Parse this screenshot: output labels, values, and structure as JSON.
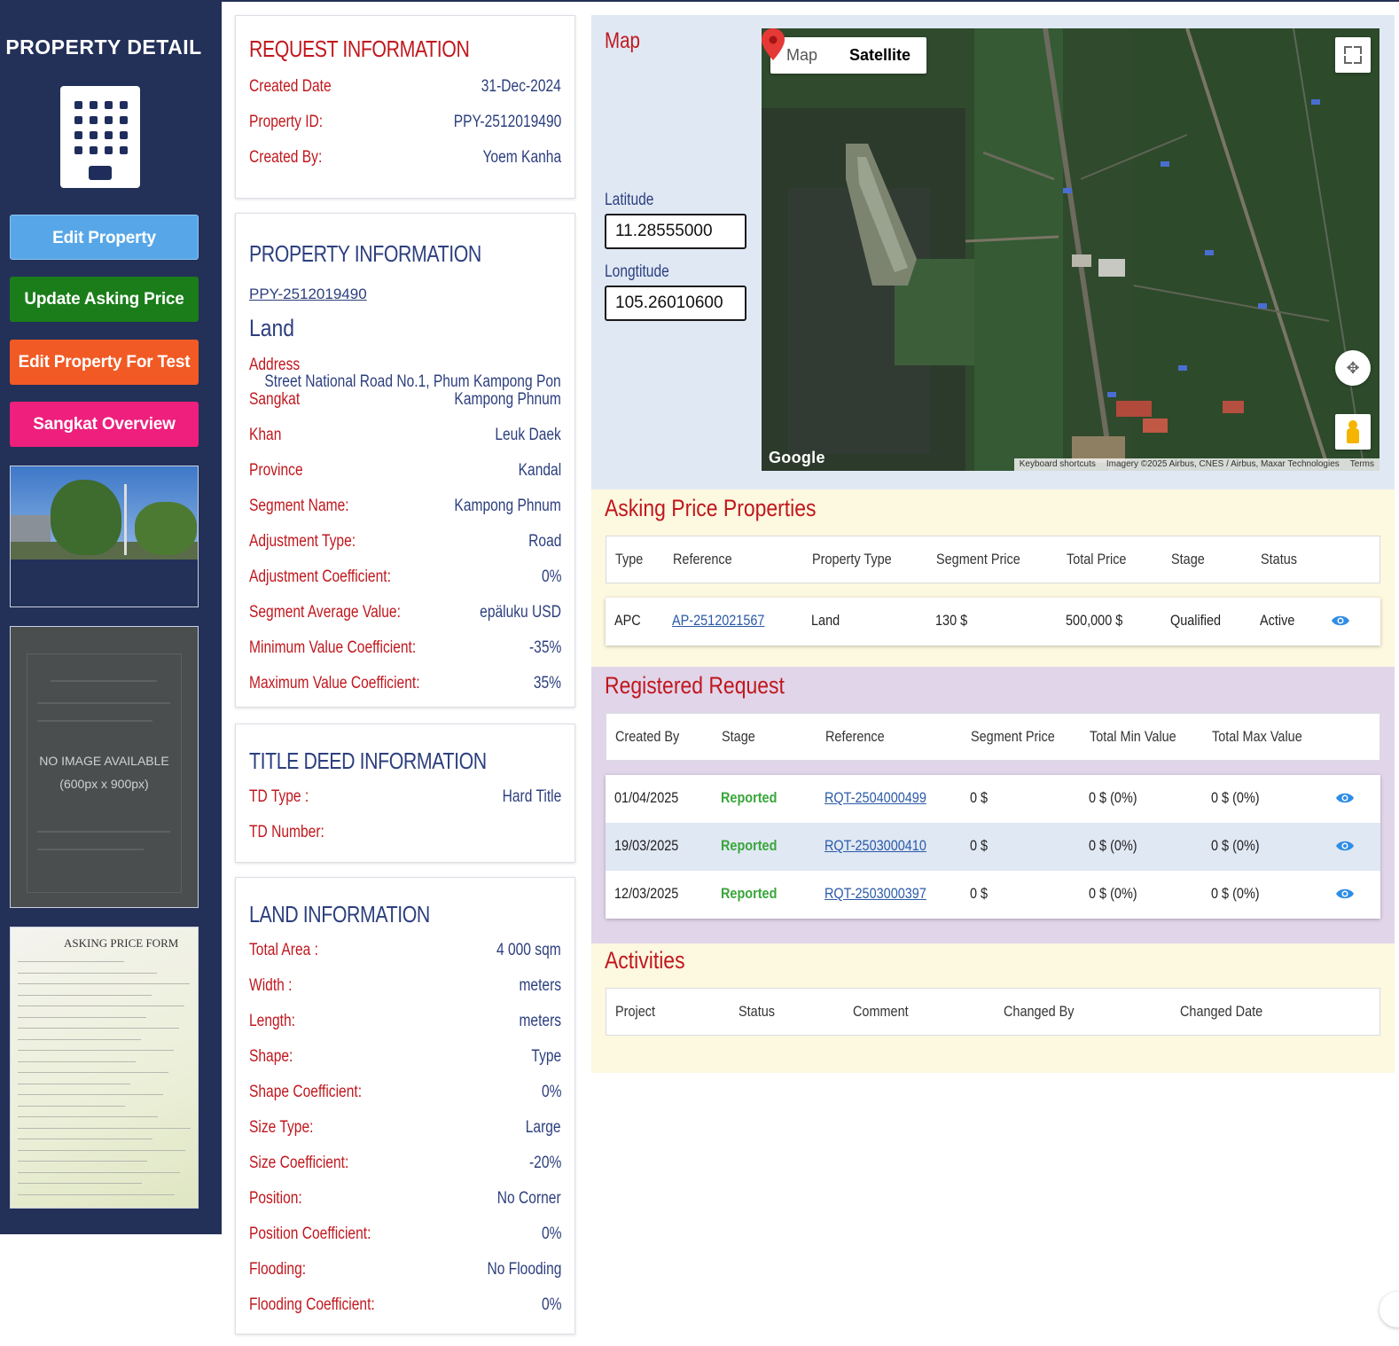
{
  "sidebar": {
    "title": "PROPERTY DETAIL",
    "buttons": {
      "edit": "Edit Property",
      "update_price": "Update Asking Price",
      "edit_test": "Edit Property For Test",
      "sangkat": "Sangkat Overview"
    },
    "no_image": {
      "line1": "NO IMAGE AVAILABLE",
      "line2": "(600px x 900px)"
    },
    "form_title": "ASKING PRICE FORM"
  },
  "request": {
    "title": "REQUEST INFORMATION",
    "rows": [
      {
        "label": "Created Date",
        "value": "31-Dec-2024"
      },
      {
        "label": "Property ID:",
        "value": "PPY-2512019490"
      },
      {
        "label": "Created By:",
        "value": "Yoem Kanha"
      }
    ]
  },
  "property": {
    "title": "PROPERTY INFORMATION",
    "id_link": "PPY-2512019490",
    "type": "Land",
    "address_label": "Address",
    "address_value": "Street National Road No.1, Phum Kampong Pon",
    "rows": [
      {
        "label": "Sangkat",
        "value": "Kampong Phnum"
      },
      {
        "label": "Khan",
        "value": "Leuk Daek"
      },
      {
        "label": "Province",
        "value": "Kandal"
      },
      {
        "label": "Segment Name:",
        "value": "Kampong Phnum"
      },
      {
        "label": "Adjustment Type:",
        "value": "Road"
      },
      {
        "label": "Adjustment Coefficient:",
        "value": "0%"
      },
      {
        "label": "Segment Average Value:",
        "value": "epäluku USD"
      },
      {
        "label": "Minimum Value Coefficient:",
        "value": "-35%"
      },
      {
        "label": "Maximum Value Coefficient:",
        "value": "35%"
      }
    ]
  },
  "title_deed": {
    "title": "TITLE DEED INFORMATION",
    "rows": [
      {
        "label": "TD Type :",
        "value": "Hard Title"
      },
      {
        "label": "TD Number:",
        "value": ""
      }
    ]
  },
  "land": {
    "title": "LAND INFORMATION",
    "rows": [
      {
        "label": "Total Area :",
        "value": "4 000 sqm"
      },
      {
        "label": "Width :",
        "value": "meters"
      },
      {
        "label": "Length:",
        "value": "meters"
      },
      {
        "label": "Shape:",
        "value": "Type"
      },
      {
        "label": "Shape Coefficient:",
        "value": "0%"
      },
      {
        "label": "Size Type:",
        "value": "Large"
      },
      {
        "label": "Size Coefficient:",
        "value": "-20%"
      },
      {
        "label": "Position:",
        "value": "No Corner"
      },
      {
        "label": "Position Coefficient:",
        "value": "0%"
      },
      {
        "label": "Flooding:",
        "value": "No Flooding"
      },
      {
        "label": "Flooding Coefficient:",
        "value": "0%"
      }
    ]
  },
  "map": {
    "title": "Map",
    "latitude_label": "Latitude",
    "latitude": "11.28555000",
    "longitude_label": "Longtitude",
    "longitude": "105.26010600",
    "tab_map": "Map",
    "tab_satellite": "Satellite",
    "google": "Google",
    "attrib": [
      "Keyboard shortcuts",
      "Imagery ©2025 Airbus, CNES / Airbus, Maxar Technologies",
      "Terms"
    ]
  },
  "asking": {
    "title": "Asking Price Properties",
    "headers": [
      "Type",
      "Reference",
      "Property Type",
      "Segment Price",
      "Total Price",
      "Stage",
      "Status"
    ],
    "rows": [
      [
        "APC",
        "AP-2512021567",
        "Land",
        "130 $",
        "500,000 $",
        "Qualified",
        "Active"
      ]
    ]
  },
  "registered": {
    "title": "Registered Request",
    "headers": [
      "Created By",
      "Stage",
      "Reference",
      "Segment Price",
      "Total Min Value",
      "Total Max Value"
    ],
    "rows": [
      [
        "01/04/2025",
        "Reported",
        "RQT-2504000499",
        "0 $",
        "0 $ (0%)",
        "0 $ (0%)"
      ],
      [
        "19/03/2025",
        "Reported",
        "RQT-2503000410",
        "0 $",
        "0 $ (0%)",
        "0 $ (0%)"
      ],
      [
        "12/03/2025",
        "Reported",
        "RQT-2503000397",
        "0 $",
        "0 $ (0%)",
        "0 $ (0%)"
      ]
    ]
  },
  "activities": {
    "title": "Activities",
    "headers": [
      "Project",
      "Status",
      "Comment",
      "Changed By",
      "Changed Date"
    ]
  },
  "colors": {
    "accent_red": "#c0171d",
    "navy": "#233058",
    "link": "#2a5aa8",
    "reported": "#39a63a"
  }
}
